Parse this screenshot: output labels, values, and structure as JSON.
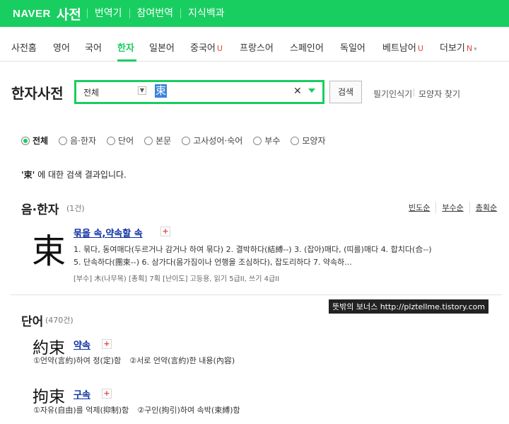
{
  "topbar": {
    "logo": "NAVER",
    "service": "사전",
    "links": [
      "번역기",
      "참여번역",
      "지식백과"
    ]
  },
  "langnav": {
    "items": [
      "사전홈",
      "영어",
      "국어",
      "한자",
      "일본어",
      "중국어",
      "프랑스어",
      "스페인어",
      "독일어",
      "베트남어",
      "더보기"
    ],
    "active": "한자",
    "u_mark": "U",
    "n_mark": "N",
    "accent_color": "#19ce60"
  },
  "search": {
    "title": "한자사전",
    "scope": "전체",
    "query": "束",
    "button": "검색",
    "tools": [
      "필기인식기",
      "모양자 찾기"
    ]
  },
  "filters": {
    "items": [
      "전체",
      "음·한자",
      "단어",
      "본문",
      "고사성어·숙어",
      "부수",
      "모양자"
    ],
    "selected": "전체"
  },
  "result_message": {
    "quoted": "'束'",
    "rest": " 에 대한 검색 결과입니다."
  },
  "hanja_section": {
    "title": "음·한자",
    "count": "(1건)",
    "sort": [
      "빈도순",
      "부수순",
      "총획순"
    ],
    "entry": {
      "char": "束",
      "link": "묶을 속,약속할 속",
      "plus": "+",
      "def_line1": "1. 묶다, 동여매다(두르거나 감거나 하여 묶다) 2. 결박하다(結縛--) 3. (잡아)매다, (띠를)매다 4. 합치다(合--)",
      "def_line2": "5. 단속하다(團束--) 6. 삼가다(몸가짐이나 언행을 조심하다), 잡도리하다 7. 약속하...",
      "meta": "[부수] 木(나무목)  [총획] 7획  [난이도] 고등용, 읽기 5급II, 쓰기 4급II"
    }
  },
  "watermark": "뜻밖의 보너스  http://plztellme.tistory.com",
  "word_section": {
    "title": "단어",
    "count": "(470건)",
    "words": [
      {
        "hanja": "約束",
        "reading": "약속",
        "plus": "+",
        "def1": "①언약(言約)하여 정(定)함",
        "def2": "②서로 언약(言約)한 내용(內容)"
      },
      {
        "hanja": "拘束",
        "reading": "구속",
        "plus": "+",
        "def1": "①자유(自由)를 억제(抑制)함",
        "def2": "②구인(拘引)하여 속박(束縛)함"
      }
    ]
  }
}
